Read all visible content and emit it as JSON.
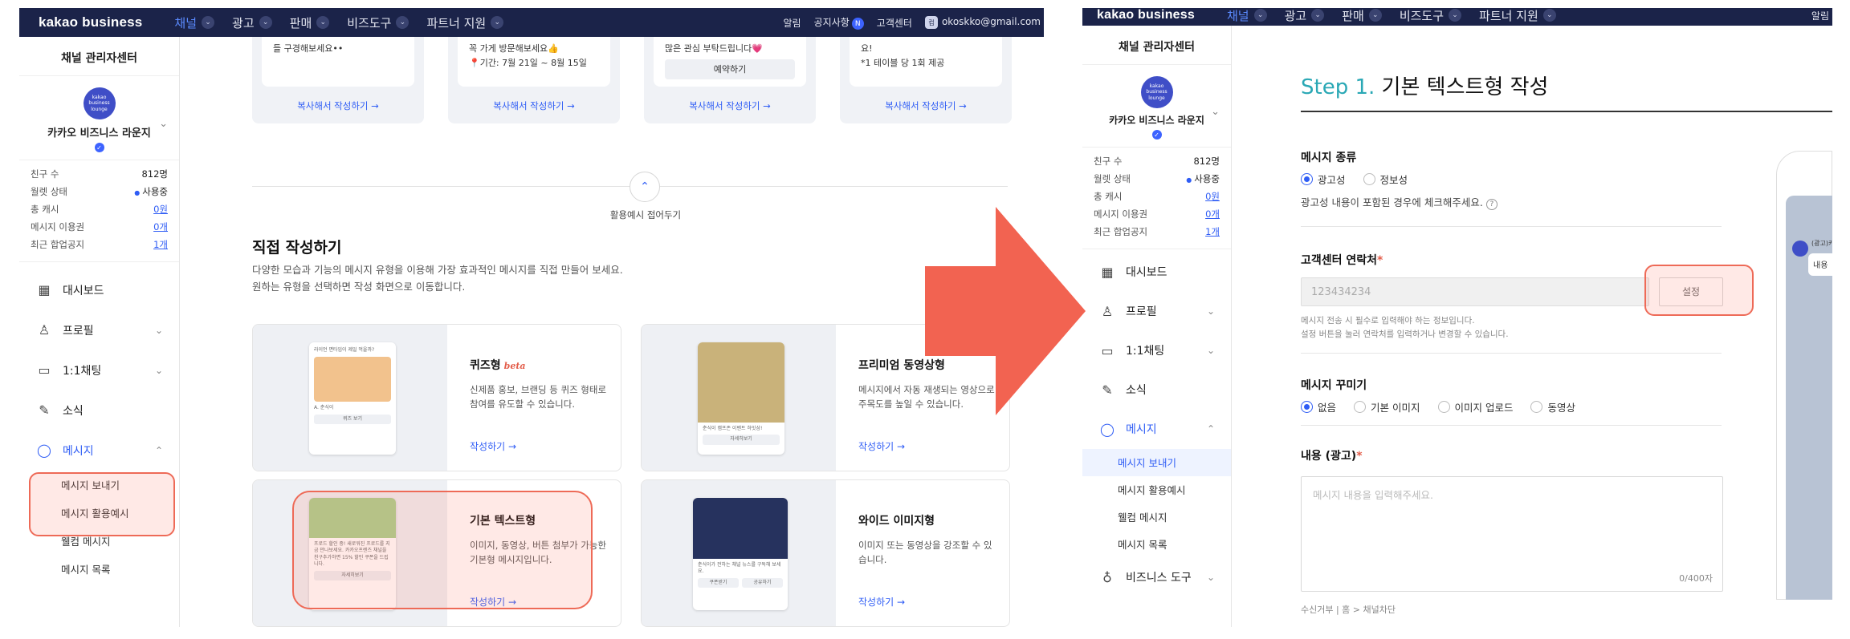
{
  "nav": {
    "logo": "kakao business",
    "items": [
      "채널",
      "광고",
      "판매",
      "비즈도구",
      "파트너 지원"
    ],
    "alerts": "알림",
    "notice": "공지사항",
    "notice_badge": "N",
    "help": "고객센터",
    "avatar_letter": "컴",
    "email": "okoskko@gmail.com"
  },
  "sidebar": {
    "title": "채널 관리자센터",
    "profile_img_text": "kakao business lounge",
    "profile_name": "카카오 비즈니스 라운지",
    "verified": "✓",
    "stats": [
      {
        "label": "친구 수",
        "value": "812명"
      },
      {
        "label": "월렛 상태",
        "value": "사용중"
      },
      {
        "label": "총 캐시",
        "value": "0원"
      },
      {
        "label": "메시지 이용권",
        "value": "0개"
      },
      {
        "label": "최근 합업공지",
        "value": "1개"
      }
    ],
    "menu": {
      "dashboard": "대시보드",
      "profile": "프로필",
      "chat": "1:1채팅",
      "news": "소식",
      "message": "메시지",
      "biztools": "비즈니스 도구"
    },
    "submenu": [
      "메시지 보내기",
      "메시지 활용예시",
      "웰컴 메시지",
      "메시지 목록"
    ]
  },
  "examples": {
    "cards": [
      {
        "text": "들 구경해보세요••",
        "button": "",
        "link": "복사해서 작성하기 →"
      },
      {
        "text": "꼭 가게 방문해보세요👍",
        "text2": "📍기간: 7월 21일 ~ 8월 15일",
        "button": "",
        "link": "복사해서 작성하기 →"
      },
      {
        "text": "많은 관심 부탁드립니다💗",
        "button": "예약하기",
        "link": "복사해서 작성하기 →"
      },
      {
        "text": "요!",
        "text2": "*1 테이블 당 1회 제공",
        "button": "",
        "link": "복사해서 작성하기 →"
      }
    ],
    "collapse_icon": "⌃",
    "collapse_label": "활용예시 접어두기"
  },
  "direct": {
    "title": "직접 작성하기",
    "desc1": "다양한 모습과 기능의 메시지 유형을 이용해 가장 효과적인 메시지를 직접 만들어 보세요.",
    "desc2": "원하는 유형을 선택하면 작성 화면으로 이동합니다.",
    "types": [
      {
        "name": "퀴즈형",
        "badge": "beta",
        "desc": "신제품 홍보, 브랜딩 등 퀴즈 형태로 참여를 유도할 수 있습니다.",
        "link": "작성하기 →",
        "phone_text": "라이언 면타입이 제일 먹을까?",
        "phone_sub": "A. 춘식이",
        "phone_btn": "퀴즈 보기"
      },
      {
        "name": "프리미엄 동영상형",
        "badge": "",
        "desc": "메시지에서 자동 재생되는 영상으로 주목도를 높일 수 있습니다.",
        "link": "작성하기 →",
        "phone_text": "춘식이 캠프존 이벤트 하잇삼!",
        "phone_sub": "",
        "phone_btn": "자세히보기"
      },
      {
        "name": "기본 텍스트형",
        "badge": "",
        "desc": "이미지, 동영상, 버튼 첨부가 가능한 기본형 메시지입니다.",
        "link": "작성하기 →",
        "phone_text": "프로드 할인 중! 새로워진 프로드를 지금 만나보세요. 카카오프렌즈 채널을 친구추가하면 15% 할인 쿠폰을 드립니다.",
        "phone_sub": "",
        "phone_btn": "자세히보기"
      },
      {
        "name": "와이드 이미지형",
        "badge": "",
        "desc": "이미지 또는 동영상을 강조할 수 있습니다.",
        "link": "작성하기 →",
        "phone_text": "춘식이가 전하는 채널 뉴스를 구독해 보세요.",
        "phone_sub": "",
        "phone_btn": "쿠폰받기",
        "phone_btn2": "공유하기"
      }
    ]
  },
  "step": {
    "num": "Step 1.",
    "title": "기본 텍스트형 작성",
    "type_label": "메시지 종류",
    "type_options": [
      "광고성",
      "정보성"
    ],
    "type_hint": "광고성 내용이 포함된 경우에 체크해주세요.",
    "cs_label": "고객센터 연락처",
    "cs_value": "123434234",
    "set_button": "설정",
    "cs_hint1": "메시지 전송 시 필수로 입력해야 하는 정보입니다.",
    "cs_hint2": "설정 버튼을 눌러 연락처를 입력하거나 변경할 수 있습니다.",
    "deco_label": "메시지 꾸미기",
    "deco_options": [
      "없음",
      "기본 이미지",
      "이미지 업로드",
      "동영상"
    ],
    "content_label": "내용 (광고)",
    "content_placeholder": "메시지 내용을 입력해주세요.",
    "counter": "0/400자",
    "footer": "수신거부 | 홈 > 채널차단",
    "preview_label": "(광고)카",
    "preview_bubble": "내용"
  },
  "colors": {
    "nav_bg": "#1b2349",
    "accent": "#2f5df5",
    "highlight": "#ee6a57",
    "arrow": "#f26351",
    "step_num": "#2aa8b5"
  }
}
